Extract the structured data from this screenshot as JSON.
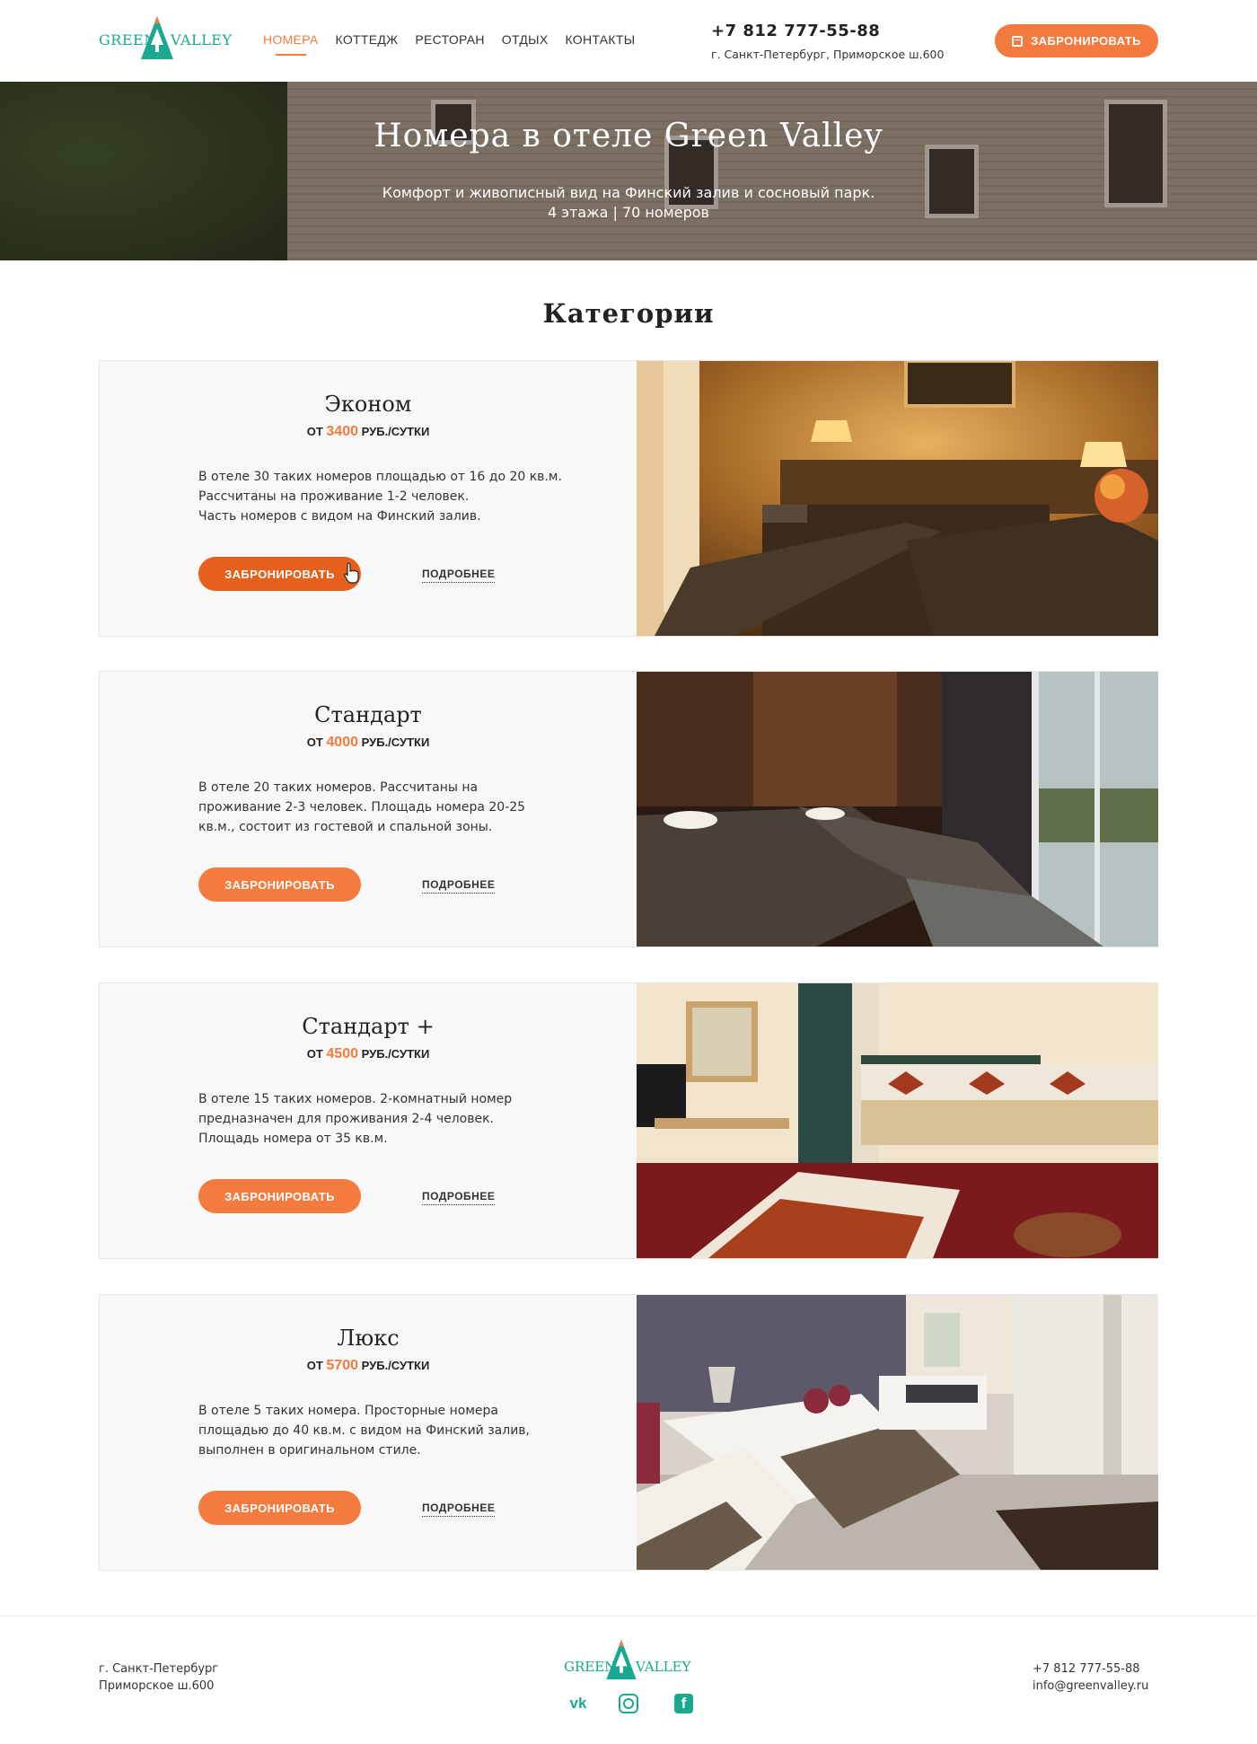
{
  "brand": {
    "logo_word_1": "GREEN",
    "logo_word_2": "VALLEY",
    "brand_color": "#1aa891"
  },
  "nav": {
    "items": [
      {
        "label": "НОМЕРА",
        "active": true
      },
      {
        "label": "КОТТЕДЖ"
      },
      {
        "label": "РЕСТОРАН"
      },
      {
        "label": "ОТДЫХ"
      },
      {
        "label": "КОНТАКТЫ"
      }
    ]
  },
  "header": {
    "phone": "+7 812 777-55-88",
    "address": "г. Санкт-Петербург, Приморское ш.600",
    "book_label": "ЗАБРОНИРОВАТЬ",
    "book_icon": "calendar-icon",
    "accent": "#f47a3e"
  },
  "hero": {
    "title": "Номера в отеле Green Valley",
    "subtitle_line_1": "Комфорт и живописный вид на Финский залив и сосновый парк.",
    "subtitle_line_2": "4 этажа | 70 номеров"
  },
  "section": {
    "title": "Категории"
  },
  "categories": [
    {
      "name": "Эконом",
      "price_prefix": "ОТ",
      "price": "3400",
      "price_unit": "РУБ./СУТКИ",
      "desc": [
        "В отеле 30 таких номеров площадью от 16 до 20 кв.м.",
        "Рассчитаны на проживание 1-2 человек.",
        "Часть номеров с видом на Финский залив."
      ],
      "book_label": "ЗАБРОНИРОВАТЬ",
      "more_label": "ПОДРОБНЕЕ"
    },
    {
      "name": "Стандарт",
      "price_prefix": "ОТ",
      "price": "4000",
      "price_unit": "РУБ./СУТКИ",
      "desc": [
        "В отеле 20 таких номеров. Рассчитаны на",
        "проживание 2-3 человек. Площадь номера 20-25",
        "кв.м., состоит из гостевой и спальной зоны."
      ],
      "book_label": "ЗАБРОНИРОВАТЬ",
      "more_label": "ПОДРОБНЕЕ"
    },
    {
      "name": "Стандарт +",
      "price_prefix": "ОТ",
      "price": "4500",
      "price_unit": "РУБ./СУТКИ",
      "desc": [
        "В отеле 15 таких номеров. 2-комнатный номер",
        "предназначен для проживания 2-4 человек.",
        "Площадь номера от 35 кв.м."
      ],
      "book_label": "ЗАБРОНИРОВАТЬ",
      "more_label": "ПОДРОБНЕЕ"
    },
    {
      "name": "Люкс",
      "price_prefix": "ОТ",
      "price": "5700",
      "price_unit": "РУБ./СУТКИ",
      "desc": [
        "В отеле 5 таких номера. Просторные номера",
        "площадью до 40 кв.м. с видом на Финский залив,",
        "выполнен в оригинальном стиле."
      ],
      "book_label": "ЗАБРОНИРОВАТЬ",
      "more_label": "ПОДРОБНЕЕ"
    }
  ],
  "footer": {
    "address_line_1": "г. Санкт-Петербург",
    "address_line_2": "Приморское ш.600",
    "phone": "+7 812 777-55-88",
    "email": "info@greenvalley.ru",
    "socials": [
      "vk-icon",
      "instagram-icon",
      "facebook-icon"
    ]
  }
}
